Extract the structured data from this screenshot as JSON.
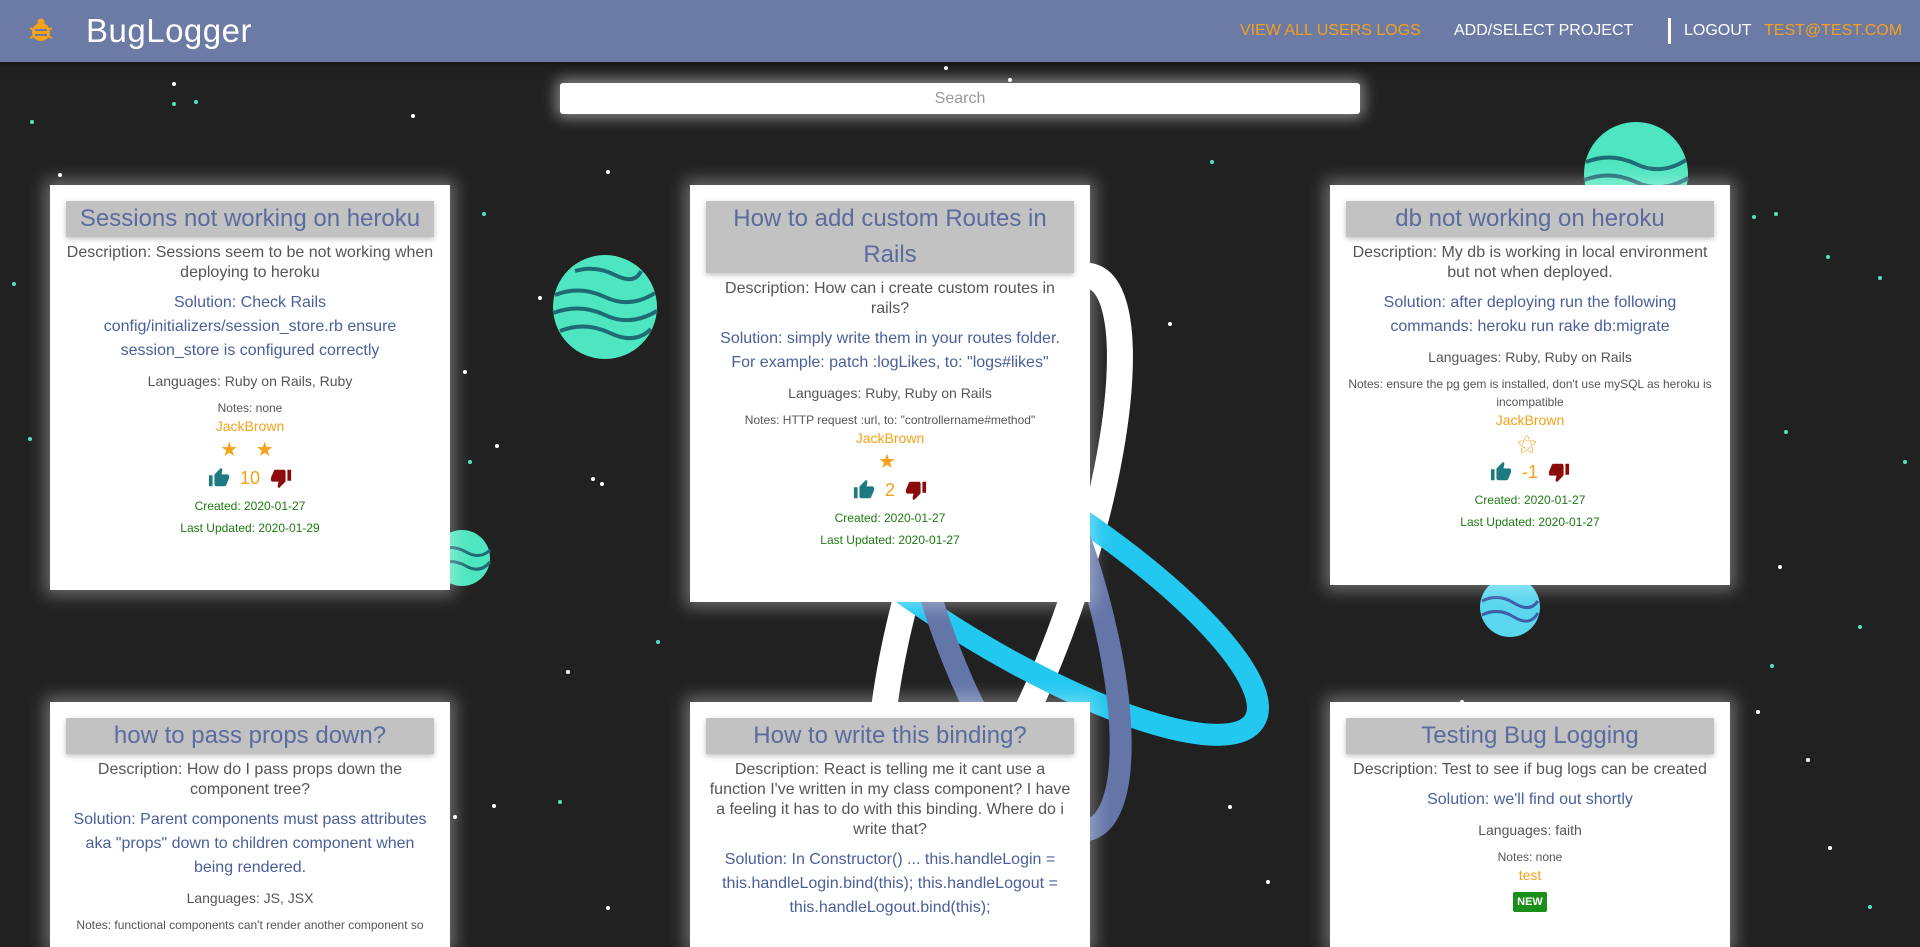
{
  "app": {
    "title": "BugLogger"
  },
  "nav": {
    "all_logs": "VIEW ALL USERS LOGS",
    "project": "ADD/SELECT PROJECT",
    "logout": "LOGOUT",
    "user": "TEST@TEST.COM"
  },
  "search": {
    "placeholder": "Search"
  },
  "colors": {
    "navbar": "#6c7aa6",
    "accent": "#f5a11a",
    "title_text": "#5b6b9e",
    "date_text": "#1e7a12"
  },
  "cards": [
    {
      "title": "Sessions not working on heroku",
      "description": "Description: Sessions seem to be not working when deploying to heroku",
      "solution": "Solution: Check Rails config/initializers/session_store.rb ensure session_store is configured correctly",
      "languages": "Languages: Ruby on Rails, Ruby",
      "notes": "Notes: none",
      "author": "JackBrown",
      "stars": "★ ★",
      "votes": "10",
      "created": "Created: 2020-01-27",
      "updated": "Last Updated: 2020-01-29"
    },
    {
      "title": "How to add custom Routes in Rails",
      "description": "Description: How can i create custom routes in rails?",
      "solution": "Solution: simply write them in your routes folder. For example: patch :logLikes, to: \"logs#likes\"",
      "languages": "Languages: Ruby, Ruby on Rails",
      "notes": "Notes: HTTP request :url, to: \"controllername#method\"",
      "author": "JackBrown",
      "stars": "★",
      "votes": "2",
      "created": "Created: 2020-01-27",
      "updated": "Last Updated: 2020-01-27"
    },
    {
      "title": "db not working on heroku",
      "description": "Description: My db is working in local environment but not when deployed.",
      "solution": "Solution: after deploying run the following commands: heroku run rake db:migrate",
      "languages": "Languages: Ruby, Ruby on Rails",
      "notes": "Notes: ensure the pg gem is installed, don't use mySQL as heroku is incompatible",
      "author": "JackBrown",
      "stars": "⚝",
      "votes": "-1",
      "created": "Created: 2020-01-27",
      "updated": "Last Updated: 2020-01-27"
    },
    {
      "title": "how to pass props down?",
      "description": "Description: How do I pass props down the component tree?",
      "solution": "Solution: Parent components must pass attributes aka \"props\" down to children component when being rendered.",
      "languages": "Languages: JS, JSX",
      "notes": "Notes: functional components can't render another component so"
    },
    {
      "title": "How to write this binding?",
      "description": "Description: React is telling me it cant use a function I've written in my class component? I have a feeling it has to do with this binding. Where do i write that?",
      "solution": "Solution: In Constructor() ... this.handleLogin = this.handleLogin.bind(this); this.handleLogout = this.handleLogout.bind(this);"
    },
    {
      "title": "Testing Bug Logging",
      "description": "Description: Test to see if bug logs can be created",
      "solution": "Solution: we'll find out shortly",
      "languages": "Languages: faith",
      "notes": "Notes: none",
      "author": "test",
      "badge": "NEW"
    }
  ]
}
